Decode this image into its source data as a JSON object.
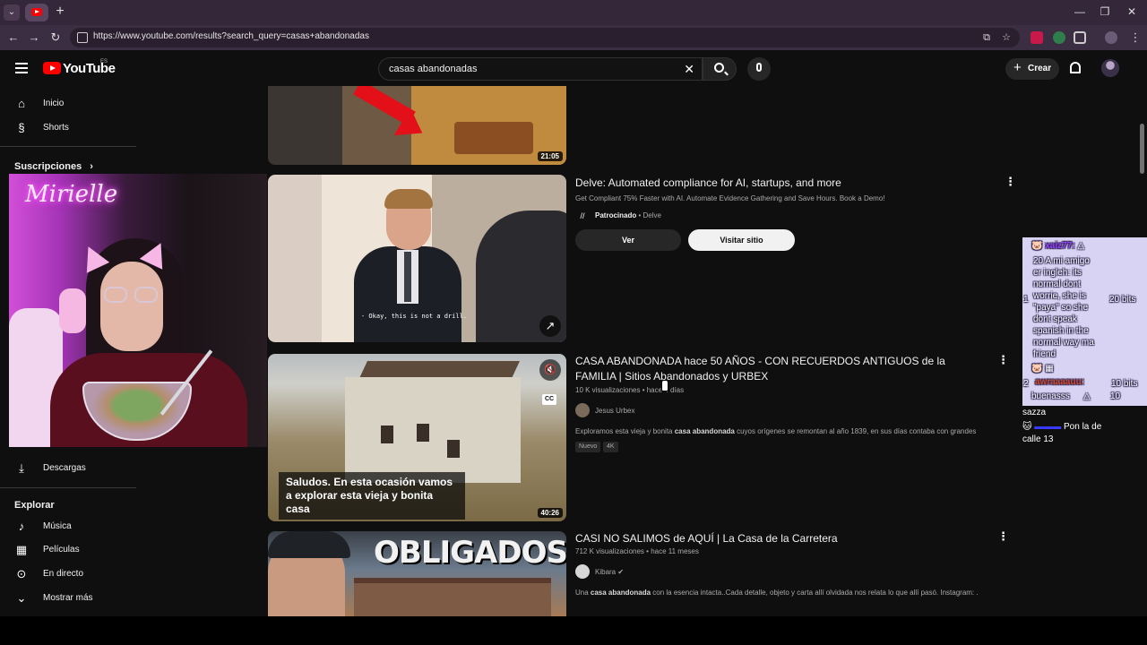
{
  "browser": {
    "url": "https://www.youtube.com/results?search_query=casas+abandonadas"
  },
  "header": {
    "logo_text": "YouTube",
    "logo_region": "ES",
    "search_value": "casas abandonadas",
    "create_label": "Crear"
  },
  "sidebar": {
    "home": "Inicio",
    "shorts": "Shorts",
    "subscriptions": "Suscripciones",
    "downloads": "Descargas",
    "explore_heading": "Explorar",
    "explore_items": [
      "Música",
      "Películas",
      "En directo",
      "Mostrar más"
    ]
  },
  "webcam": {
    "neon_sign": "Mirielle"
  },
  "results": [
    {
      "duration": "21:05"
    },
    {
      "title": "Delve: Automated compliance for AI, startups, and more",
      "description": "Get Compliant 75% Faster with AI. Automate Evidence Gathering and Save Hours. Book a Demo!",
      "sponsored": "Patrocinado",
      "advertiser": "Delve",
      "caption": "- Okay, this is not a drill.",
      "btn_primary": "Ver",
      "btn_secondary": "Visitar sitio"
    },
    {
      "title": "CASA ABANDONADA hace 50 AÑOS - CON RECUERDOS ANTIGUOS de la FAMILIA | Sitios Abandonados y URBEX",
      "views": "10 K visualizaciones",
      "age": "hace 4 días",
      "channel": "Jesus Urbex",
      "desc_pre": "Exploramos esta vieja y bonita ",
      "desc_bold": "casa abandonada",
      "desc_post": " cuyos orígenes se remontan al año 1839, en sus días contaba con grandes ...",
      "badges": [
        "Nuevo",
        "4K"
      ],
      "subtitle": "Saludos. En esta ocasión vamos a explorar esta vieja y bonita casa",
      "cc": "CC",
      "duration": "40:26"
    },
    {
      "title": "CASI NO SALIMOS de AQUÍ | La Casa de la Carretera",
      "views": "712 K visualizaciones",
      "age": "hace 11 meses",
      "channel": "Kibara",
      "desc_pre": "Una ",
      "desc_bold": "casa abandonada",
      "desc_post": " con la esencia intacta..Cada detalle, objeto y carta allí olvidada nos relata lo que allí pasó. Instagram: ...",
      "thumb_text": "OBLIGADOS"
    }
  ],
  "chat": {
    "user1": "xaiz77:",
    "msg1": [
      "20 A mi amigo",
      "er ingleh: its",
      "normal dont",
      "worrie, she is",
      "\"paya\" so she",
      "dont speak",
      "spanish in the",
      "normal way ma",
      "friend"
    ],
    "side_num1": "1",
    "bits1": "20 bits",
    "user2": "awraaaauu:",
    "msg2": "buenasss",
    "side_num2": "2",
    "bits2": "10 bits",
    "count2": "10",
    "plain1": "sazza",
    "plain2": "Pon la de",
    "plain3": "calle 13"
  }
}
